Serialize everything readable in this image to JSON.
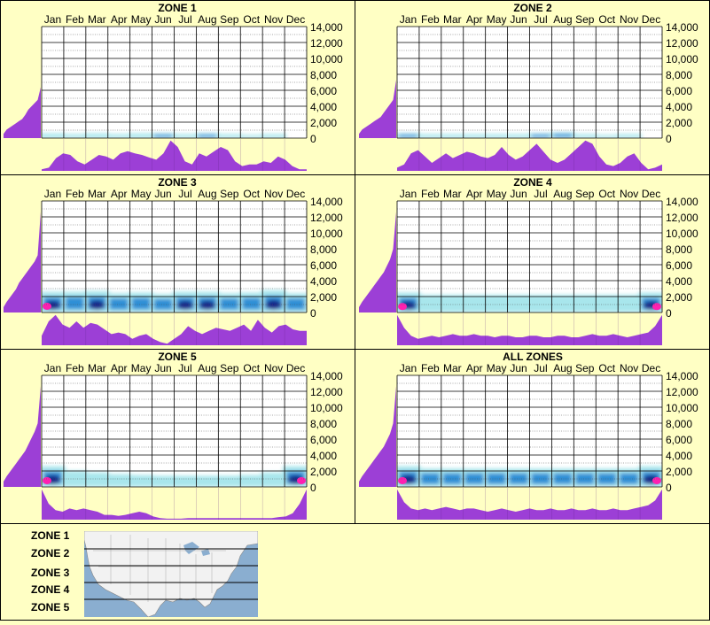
{
  "months": [
    "Jan",
    "Feb",
    "Mar",
    "Apr",
    "May",
    "Jun",
    "Jul",
    "Aug",
    "Sep",
    "Oct",
    "Nov",
    "Dec"
  ],
  "y_ticks": [
    "14,000",
    "12,000",
    "10,000",
    "8,000",
    "6,000",
    "4,000",
    "2,000",
    "0"
  ],
  "colors": {
    "background": "#ffffc4",
    "profile_fill": "#9c3fd6",
    "grid_line": "#000000",
    "heat_light": "#a8e6ec",
    "heat_mid": "#2f8fd6",
    "heat_dark": "#12208a",
    "heat_peak": "#ff20b0"
  },
  "chart_data": [
    {
      "type": "heatmap",
      "title": "ZONE 1",
      "x": [
        "Jan",
        "Feb",
        "Mar",
        "Apr",
        "May",
        "Jun",
        "Jul",
        "Aug",
        "Sep",
        "Oct",
        "Nov",
        "Dec"
      ],
      "ylim": [
        0,
        14000
      ],
      "density_bands": [
        {
          "month": "Jan",
          "low": 0,
          "high": 600,
          "level": 1
        },
        {
          "month": "Feb",
          "low": 0,
          "high": 500,
          "level": 1
        },
        {
          "month": "Mar",
          "low": 0,
          "high": 600,
          "level": 1
        },
        {
          "month": "Apr",
          "low": 0,
          "high": 500,
          "level": 1
        },
        {
          "month": "May",
          "low": 0,
          "high": 600,
          "level": 1
        },
        {
          "month": "Jun",
          "low": 0,
          "high": 600,
          "level": 2
        },
        {
          "month": "Jul",
          "low": 0,
          "high": 500,
          "level": 1
        },
        {
          "month": "Aug",
          "low": 0,
          "high": 600,
          "level": 2
        },
        {
          "month": "Sep",
          "low": 0,
          "high": 500,
          "level": 1
        },
        {
          "month": "Oct",
          "low": 0,
          "high": 400,
          "level": 1
        },
        {
          "month": "Nov",
          "low": 0,
          "high": 500,
          "level": 1
        }
      ],
      "elevation_profile": [
        0.04,
        0.08,
        0.1,
        0.12,
        0.14,
        0.16,
        0.18,
        0.22,
        0.27,
        0.3,
        0.33,
        0.36,
        0.48
      ],
      "month_profile": [
        0.05,
        0.1,
        0.4,
        0.55,
        0.5,
        0.3,
        0.2,
        0.35,
        0.5,
        0.45,
        0.35,
        0.55,
        0.62,
        0.55,
        0.5,
        0.42,
        0.35,
        0.55,
        0.95,
        0.75,
        0.3,
        0.2,
        0.55,
        0.45,
        0.6,
        0.75,
        0.65,
        0.3,
        0.15,
        0.2,
        0.2,
        0.3,
        0.25,
        0.45,
        0.35,
        0.15,
        0.05,
        0.05
      ]
    },
    {
      "type": "heatmap",
      "title": "ZONE 2",
      "x": [
        "Jan",
        "Feb",
        "Mar",
        "Apr",
        "May",
        "Jun",
        "Jul",
        "Aug",
        "Sep",
        "Oct",
        "Nov",
        "Dec"
      ],
      "ylim": [
        0,
        14000
      ],
      "density_bands": [
        {
          "month": "Jan",
          "low": 0,
          "high": 600,
          "level": 2
        },
        {
          "month": "Feb",
          "low": 0,
          "high": 500,
          "level": 1
        },
        {
          "month": "Mar",
          "low": 0,
          "high": 500,
          "level": 1
        },
        {
          "month": "Apr",
          "low": 0,
          "high": 500,
          "level": 1
        },
        {
          "month": "May",
          "low": 0,
          "high": 500,
          "level": 1
        },
        {
          "month": "Jun",
          "low": 0,
          "high": 500,
          "level": 1
        },
        {
          "month": "Jul",
          "low": 0,
          "high": 600,
          "level": 2
        },
        {
          "month": "Aug",
          "low": 0,
          "high": 700,
          "level": 2
        },
        {
          "month": "Sep",
          "low": 0,
          "high": 500,
          "level": 1
        },
        {
          "month": "Oct",
          "low": 0,
          "high": 400,
          "level": 1
        },
        {
          "month": "Nov",
          "low": 0,
          "high": 500,
          "level": 1
        }
      ],
      "elevation_profile": [
        0.04,
        0.08,
        0.1,
        0.12,
        0.14,
        0.16,
        0.18,
        0.2,
        0.24,
        0.28,
        0.32,
        0.36,
        0.55
      ],
      "month_profile": [
        0.1,
        0.2,
        0.55,
        0.65,
        0.45,
        0.25,
        0.4,
        0.55,
        0.4,
        0.5,
        0.6,
        0.55,
        0.45,
        0.4,
        0.5,
        0.75,
        0.5,
        0.35,
        0.45,
        0.65,
        0.85,
        0.6,
        0.35,
        0.25,
        0.35,
        0.55,
        0.75,
        0.95,
        0.85,
        0.45,
        0.2,
        0.15,
        0.25,
        0.45,
        0.55,
        0.25,
        0.05,
        0.1,
        0.2
      ]
    },
    {
      "type": "heatmap",
      "title": "ZONE 3",
      "x": [
        "Jan",
        "Feb",
        "Mar",
        "Apr",
        "May",
        "Jun",
        "Jul",
        "Aug",
        "Sep",
        "Oct",
        "Nov",
        "Dec"
      ],
      "ylim": [
        0,
        14000
      ],
      "density_bands": [
        {
          "month": "Jan",
          "low": 0,
          "high": 2600,
          "level": 3
        },
        {
          "month": "Feb",
          "low": 0,
          "high": 2600,
          "level": 2
        },
        {
          "month": "Mar",
          "low": 0,
          "high": 2700,
          "level": 3
        },
        {
          "month": "Apr",
          "low": 0,
          "high": 2400,
          "level": 2
        },
        {
          "month": "May",
          "low": 0,
          "high": 2500,
          "level": 2
        },
        {
          "month": "Jun",
          "low": 0,
          "high": 2300,
          "level": 2
        },
        {
          "month": "Jul",
          "low": 0,
          "high": 2600,
          "level": 3
        },
        {
          "month": "Aug",
          "low": 0,
          "high": 2600,
          "level": 3
        },
        {
          "month": "Sep",
          "low": 0,
          "high": 2400,
          "level": 2
        },
        {
          "month": "Oct",
          "low": 0,
          "high": 2500,
          "level": 2
        },
        {
          "month": "Nov",
          "low": 0,
          "high": 2800,
          "level": 3
        },
        {
          "month": "Dec",
          "low": 0,
          "high": 2400,
          "level": 2
        }
      ],
      "elevation_profile": [
        0.05,
        0.1,
        0.14,
        0.18,
        0.22,
        0.28,
        0.32,
        0.36,
        0.4,
        0.44,
        0.48,
        0.54,
        0.95
      ],
      "month_profile": [
        0.3,
        0.75,
        0.95,
        0.65,
        0.55,
        0.75,
        0.55,
        0.7,
        0.65,
        0.5,
        0.35,
        0.4,
        0.35,
        0.2,
        0.3,
        0.35,
        0.2,
        0.1,
        0.05,
        0.2,
        0.35,
        0.6,
        0.45,
        0.35,
        0.45,
        0.55,
        0.5,
        0.45,
        0.55,
        0.65,
        0.45,
        0.8,
        0.55,
        0.4,
        0.6,
        0.65,
        0.5,
        0.45,
        0.45
      ]
    },
    {
      "type": "heatmap",
      "title": "ZONE 4",
      "x": [
        "Jan",
        "Feb",
        "Mar",
        "Apr",
        "May",
        "Jun",
        "Jul",
        "Aug",
        "Sep",
        "Oct",
        "Nov",
        "Dec"
      ],
      "ylim": [
        0,
        14000
      ],
      "density_bands": [
        {
          "month": "Jan",
          "low": 0,
          "high": 2500,
          "level": 3
        },
        {
          "month": "Feb",
          "low": 0,
          "high": 2200,
          "level": 1
        },
        {
          "month": "Mar",
          "low": 0,
          "high": 2200,
          "level": 1
        },
        {
          "month": "Apr",
          "low": 0,
          "high": 2200,
          "level": 1
        },
        {
          "month": "May",
          "low": 0,
          "high": 2200,
          "level": 1
        },
        {
          "month": "Jun",
          "low": 0,
          "high": 2200,
          "level": 1
        },
        {
          "month": "Jul",
          "low": 0,
          "high": 2200,
          "level": 1
        },
        {
          "month": "Aug",
          "low": 0,
          "high": 2200,
          "level": 1
        },
        {
          "month": "Sep",
          "low": 0,
          "high": 2200,
          "level": 1
        },
        {
          "month": "Oct",
          "low": 0,
          "high": 2200,
          "level": 1
        },
        {
          "month": "Nov",
          "low": 0,
          "high": 2200,
          "level": 1
        },
        {
          "month": "Dec",
          "low": 0,
          "high": 2500,
          "level": 3
        }
      ],
      "elevation_profile": [
        0.05,
        0.1,
        0.14,
        0.18,
        0.22,
        0.26,
        0.3,
        0.34,
        0.38,
        0.44,
        0.5,
        0.6,
        0.95
      ],
      "month_profile": [
        0.95,
        0.55,
        0.3,
        0.2,
        0.25,
        0.3,
        0.25,
        0.3,
        0.35,
        0.3,
        0.3,
        0.35,
        0.3,
        0.3,
        0.25,
        0.3,
        0.3,
        0.25,
        0.25,
        0.3,
        0.3,
        0.25,
        0.25,
        0.3,
        0.3,
        0.25,
        0.25,
        0.3,
        0.35,
        0.3,
        0.3,
        0.35,
        0.3,
        0.25,
        0.3,
        0.35,
        0.4,
        0.6,
        0.95
      ]
    },
    {
      "type": "heatmap",
      "title": "ZONE 5",
      "x": [
        "Jan",
        "Feb",
        "Mar",
        "Apr",
        "May",
        "Jun",
        "Jul",
        "Aug",
        "Sep",
        "Oct",
        "Nov",
        "Dec"
      ],
      "ylim": [
        0,
        14000
      ],
      "density_bands": [
        {
          "month": "Jan",
          "low": 0,
          "high": 2600,
          "level": 3
        },
        {
          "month": "Feb",
          "low": 0,
          "high": 2000,
          "level": 1
        },
        {
          "month": "Mar",
          "low": 0,
          "high": 1800,
          "level": 1
        },
        {
          "month": "Apr",
          "low": 0,
          "high": 1600,
          "level": 1
        },
        {
          "month": "May",
          "low": 0,
          "high": 1500,
          "level": 1
        },
        {
          "month": "Jun",
          "low": 0,
          "high": 1400,
          "level": 1
        },
        {
          "month": "Jul",
          "low": 0,
          "high": 1400,
          "level": 1
        },
        {
          "month": "Aug",
          "low": 0,
          "high": 1400,
          "level": 1
        },
        {
          "month": "Sep",
          "low": 0,
          "high": 1400,
          "level": 1
        },
        {
          "month": "Oct",
          "low": 0,
          "high": 1500,
          "level": 1
        },
        {
          "month": "Nov",
          "low": 0,
          "high": 1800,
          "level": 1
        },
        {
          "month": "Dec",
          "low": 0,
          "high": 2600,
          "level": 3
        }
      ],
      "elevation_profile": [
        0.05,
        0.1,
        0.14,
        0.18,
        0.22,
        0.26,
        0.3,
        0.34,
        0.4,
        0.46,
        0.52,
        0.6,
        0.95
      ],
      "month_profile": [
        0.95,
        0.5,
        0.3,
        0.25,
        0.35,
        0.3,
        0.35,
        0.3,
        0.25,
        0.15,
        0.15,
        0.12,
        0.15,
        0.2,
        0.25,
        0.2,
        0.1,
        0.05,
        0.03,
        0.03,
        0.03,
        0.05,
        0.05,
        0.05,
        0.05,
        0.05,
        0.05,
        0.05,
        0.05,
        0.05,
        0.05,
        0.05,
        0.05,
        0.05,
        0.08,
        0.1,
        0.2,
        0.5,
        0.95
      ]
    },
    {
      "type": "heatmap",
      "title": "ALL ZONES",
      "x": [
        "Jan",
        "Feb",
        "Mar",
        "Apr",
        "May",
        "Jun",
        "Jul",
        "Aug",
        "Sep",
        "Oct",
        "Nov",
        "Dec"
      ],
      "ylim": [
        0,
        14000
      ],
      "density_bands": [
        {
          "month": "Jan",
          "low": 0,
          "high": 2600,
          "level": 3
        },
        {
          "month": "Feb",
          "low": 0,
          "high": 2300,
          "level": 2
        },
        {
          "month": "Mar",
          "low": 0,
          "high": 2300,
          "level": 2
        },
        {
          "month": "Apr",
          "low": 0,
          "high": 2300,
          "level": 2
        },
        {
          "month": "May",
          "low": 0,
          "high": 2300,
          "level": 2
        },
        {
          "month": "Jun",
          "low": 0,
          "high": 2300,
          "level": 2
        },
        {
          "month": "Jul",
          "low": 0,
          "high": 2300,
          "level": 2
        },
        {
          "month": "Aug",
          "low": 0,
          "high": 2300,
          "level": 2
        },
        {
          "month": "Sep",
          "low": 0,
          "high": 2300,
          "level": 2
        },
        {
          "month": "Oct",
          "low": 0,
          "high": 2300,
          "level": 2
        },
        {
          "month": "Nov",
          "low": 0,
          "high": 2300,
          "level": 2
        },
        {
          "month": "Dec",
          "low": 0,
          "high": 2600,
          "level": 3
        }
      ],
      "elevation_profile": [
        0.05,
        0.1,
        0.14,
        0.18,
        0.22,
        0.26,
        0.3,
        0.34,
        0.38,
        0.44,
        0.5,
        0.6,
        0.95
      ],
      "month_profile": [
        0.95,
        0.55,
        0.35,
        0.3,
        0.35,
        0.3,
        0.35,
        0.4,
        0.35,
        0.3,
        0.35,
        0.35,
        0.3,
        0.25,
        0.3,
        0.35,
        0.3,
        0.25,
        0.3,
        0.35,
        0.3,
        0.3,
        0.35,
        0.3,
        0.3,
        0.35,
        0.3,
        0.3,
        0.35,
        0.3,
        0.3,
        0.35,
        0.3,
        0.3,
        0.35,
        0.4,
        0.45,
        0.6,
        0.95
      ]
    }
  ],
  "legend": {
    "zone_labels": [
      "ZONE 1",
      "ZONE 2",
      "ZONE 3",
      "ZONE 4",
      "ZONE 5"
    ]
  }
}
